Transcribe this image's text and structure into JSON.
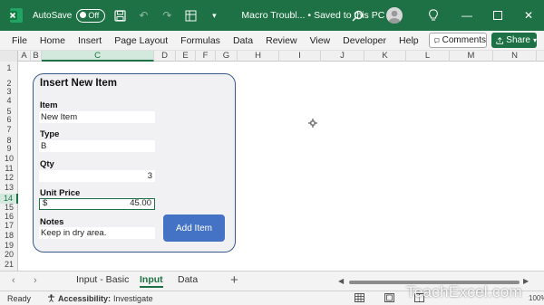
{
  "title_bar": {
    "autosave_label": "AutoSave",
    "autosave_state": "Off",
    "file_title": "Macro Troubl...",
    "save_status": "Saved to this PC",
    "dropdown_glyph": "⌄"
  },
  "menu": {
    "items": [
      "File",
      "Home",
      "Insert",
      "Page Layout",
      "Formulas",
      "Data",
      "Review",
      "View",
      "Developer",
      "Help"
    ],
    "comments_label": "Comments",
    "share_label": "Share"
  },
  "grid": {
    "columns": [
      "A",
      "B",
      "C",
      "D",
      "E",
      "F",
      "G",
      "H",
      "I",
      "J",
      "K",
      "L",
      "M",
      "N"
    ],
    "selected_column": "C",
    "rows": [
      "1",
      "2",
      "3",
      "4",
      "5",
      "6",
      "7",
      "8",
      "9",
      "10",
      "11",
      "12",
      "13",
      "14",
      "15",
      "16",
      "17",
      "18",
      "19",
      "20",
      "21"
    ],
    "selected_row": "14"
  },
  "form": {
    "title": "Insert New Item",
    "fields": {
      "item": {
        "label": "Item",
        "value": "New Item"
      },
      "type": {
        "label": "Type",
        "value": "B"
      },
      "qty": {
        "label": "Qty",
        "value": "3"
      },
      "unit_price": {
        "label": "Unit Price",
        "prefix": "$",
        "value": "45.00"
      },
      "notes": {
        "label": "Notes",
        "value": "Keep in dry area."
      }
    },
    "add_button_label": "Add Item"
  },
  "sheet_tabs": {
    "tabs": [
      "Input - Basic",
      "Input",
      "Data"
    ],
    "active": "Input",
    "add_label": "+"
  },
  "status_bar": {
    "ready": "Ready",
    "accessibility_label": "Accessibility:",
    "accessibility_value": "Investigate",
    "zoom": "100%"
  },
  "watermark": "TeachExcel.com",
  "colors": {
    "excel_green": "#1e7145",
    "panel_border": "#3a5a8c",
    "button_blue": "#4472c4"
  },
  "icons": [
    "excel-logo-icon",
    "save-icon",
    "undo-icon",
    "redo-icon",
    "customize-icon",
    "search-icon",
    "lightbulb-icon",
    "minimize-icon",
    "maximize-icon",
    "close-icon",
    "comment-icon",
    "share-icon",
    "accessibility-icon",
    "normal-view-icon",
    "page-layout-icon",
    "page-break-icon"
  ]
}
